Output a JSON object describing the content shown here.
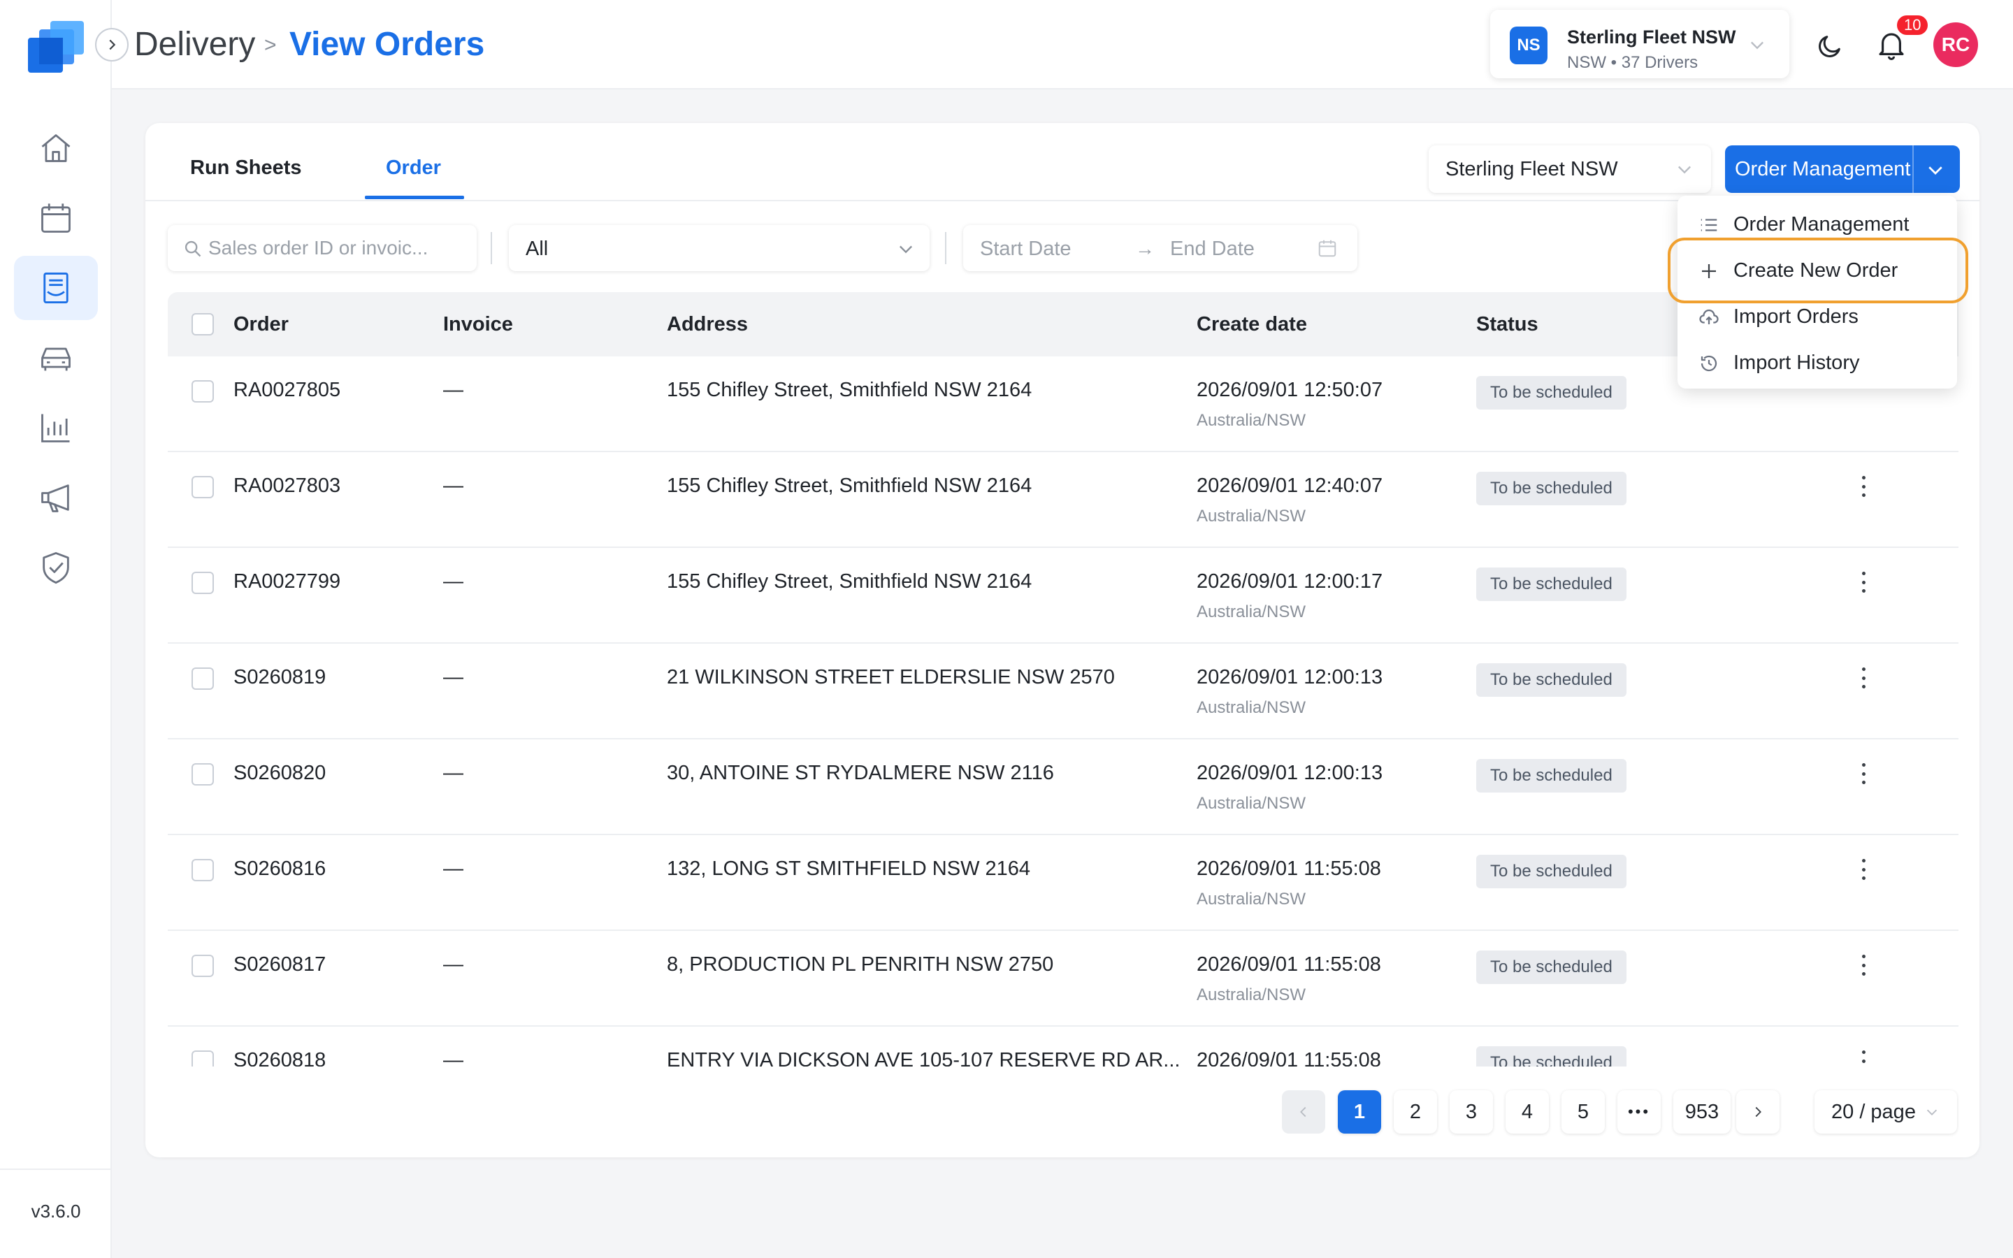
{
  "app": {
    "version": "v3.6.0"
  },
  "breadcrumb": {
    "root": "Delivery",
    "separator": ">",
    "current": "View Orders"
  },
  "fleet": {
    "initials": "NS",
    "name": "Sterling Fleet NSW",
    "subtitle": "NSW • 37 Drivers"
  },
  "notifications": {
    "count": "10"
  },
  "user": {
    "initials": "RC"
  },
  "sidebar": {
    "items": [
      {
        "name": "home-icon"
      },
      {
        "name": "calendar-icon"
      },
      {
        "name": "orders-icon",
        "active": true
      },
      {
        "name": "vehicle-icon"
      },
      {
        "name": "chart-icon"
      },
      {
        "name": "megaphone-icon"
      },
      {
        "name": "shield-icon"
      }
    ]
  },
  "tabs": [
    {
      "label": "Run Sheets",
      "active": false
    },
    {
      "label": "Order",
      "active": true
    }
  ],
  "toolbar": {
    "fleet_select": "Sterling Fleet NSW",
    "order_management_label": "Order Management"
  },
  "filters": {
    "search_placeholder": "Sales order ID or invoic...",
    "status_value": "All",
    "start_date_placeholder": "Start Date",
    "date_arrow": "→",
    "end_date_placeholder": "End Date"
  },
  "table": {
    "columns": [
      "Order",
      "Invoice",
      "Address",
      "Create date",
      "Status"
    ],
    "rows": [
      {
        "order": "RA0027805",
        "invoice": "—",
        "address": "155 Chifley Street, Smithfield NSW 2164",
        "date": "2026/09/01 12:50:07",
        "tz": "Australia/NSW",
        "status": "To be scheduled"
      },
      {
        "order": "RA0027803",
        "invoice": "—",
        "address": "155 Chifley Street, Smithfield NSW 2164",
        "date": "2026/09/01 12:40:07",
        "tz": "Australia/NSW",
        "status": "To be scheduled"
      },
      {
        "order": "RA0027799",
        "invoice": "—",
        "address": "155 Chifley Street, Smithfield NSW 2164",
        "date": "2026/09/01 12:00:17",
        "tz": "Australia/NSW",
        "status": "To be scheduled"
      },
      {
        "order": "S0260819",
        "invoice": "—",
        "address": "21 WILKINSON STREET ELDERSLIE NSW 2570",
        "date": "2026/09/01 12:00:13",
        "tz": "Australia/NSW",
        "status": "To be scheduled"
      },
      {
        "order": "S0260820",
        "invoice": "—",
        "address": "30, ANTOINE ST RYDALMERE NSW 2116",
        "date": "2026/09/01 12:00:13",
        "tz": "Australia/NSW",
        "status": "To be scheduled"
      },
      {
        "order": "S0260816",
        "invoice": "—",
        "address": "132, LONG ST SMITHFIELD NSW 2164",
        "date": "2026/09/01 11:55:08",
        "tz": "Australia/NSW",
        "status": "To be scheduled"
      },
      {
        "order": "S0260817",
        "invoice": "—",
        "address": "8, PRODUCTION PL PENRITH NSW 2750",
        "date": "2026/09/01 11:55:08",
        "tz": "Australia/NSW",
        "status": "To be scheduled"
      },
      {
        "order": "S0260818",
        "invoice": "—",
        "address": "ENTRY VIA DICKSON AVE 105-107 RESERVE RD AR...",
        "date": "2026/09/01 11:55:08",
        "tz": "",
        "status": "To be scheduled"
      }
    ]
  },
  "pagination": {
    "pages": [
      "1",
      "2",
      "3",
      "4",
      "5"
    ],
    "current": "1",
    "ellipsis": "•••",
    "last": "953",
    "page_size": "20 / page"
  },
  "order_menu": {
    "items": [
      {
        "label": "Order Management",
        "icon": "list-icon"
      },
      {
        "label": "Create New Order",
        "icon": "plus-icon",
        "highlighted": true
      },
      {
        "label": "Import Orders",
        "icon": "cloud-upload-icon"
      },
      {
        "label": "Import History",
        "icon": "history-icon"
      }
    ]
  },
  "colors": {
    "accent": "#1a6fe6",
    "highlight": "#f0a02f",
    "badge": "#f5222d",
    "avatar": "#ea2b5f"
  }
}
